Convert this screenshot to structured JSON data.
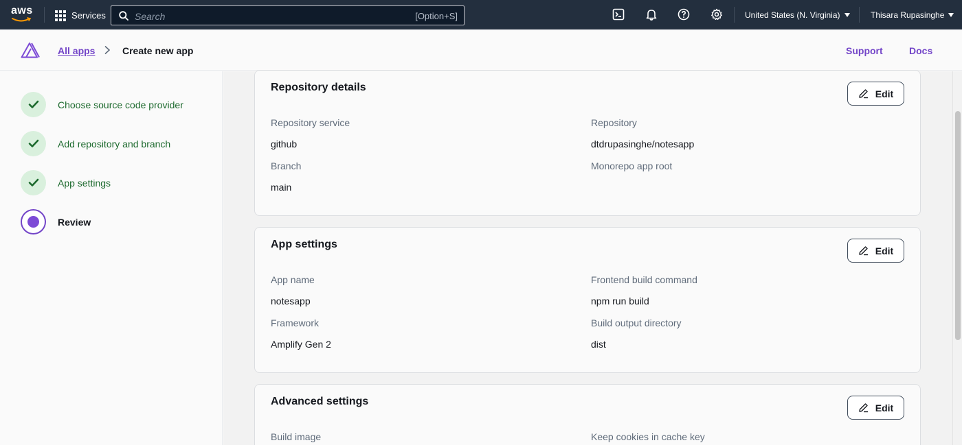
{
  "topnav": {
    "logo_text": "aws",
    "services_label": "Services",
    "search_placeholder": "Search",
    "search_shortcut": "[Option+S]",
    "region": "United States (N. Virginia)",
    "user": "Thisara Rupasinghe",
    "icons": [
      "cloudshell-icon",
      "bell-icon",
      "help-icon",
      "settings-icon"
    ]
  },
  "header": {
    "breadcrumb_link": "All apps",
    "breadcrumb_current": "Create new app",
    "support_label": "Support",
    "docs_label": "Docs"
  },
  "steps": [
    {
      "label": "Choose source code provider",
      "state": "complete"
    },
    {
      "label": "Add repository and branch",
      "state": "complete"
    },
    {
      "label": "App settings",
      "state": "complete"
    },
    {
      "label": "Review",
      "state": "current"
    }
  ],
  "cards": {
    "repo": {
      "title": "Repository details",
      "edit_label": "Edit",
      "service_label": "Repository service",
      "service_value": "github",
      "repository_label": "Repository",
      "repository_value": "dtdrupasinghe/notesapp",
      "branch_label": "Branch",
      "branch_value": "main",
      "monorepo_label": "Monorepo app root"
    },
    "app": {
      "title": "App settings",
      "edit_label": "Edit",
      "name_label": "App name",
      "name_value": "notesapp",
      "frontend_label": "Frontend build command",
      "frontend_value": "npm run build",
      "framework_label": "Framework",
      "framework_value": "Amplify Gen 2",
      "output_label": "Build output directory",
      "output_value": "dist"
    },
    "advanced": {
      "title": "Advanced settings",
      "edit_label": "Edit",
      "build_image_label": "Build image",
      "cookies_label": "Keep cookies in cache key"
    }
  },
  "colors": {
    "nav_bg": "#232f3e",
    "accent": "#7345c8",
    "success": "#1d6a2e",
    "success_bg": "#d9f0dd"
  }
}
